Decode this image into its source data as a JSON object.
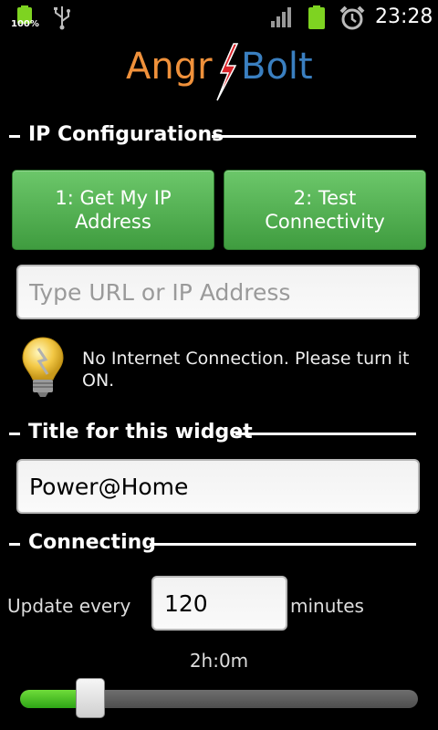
{
  "status_bar": {
    "battery_percent_label": "100%",
    "time": "23:28"
  },
  "app": {
    "logo_part1": "Angr",
    "logo_part2": "Bolt",
    "brand_orange": "#f0913b",
    "brand_blue": "#3a7fc0",
    "accent_green": "#4caf50"
  },
  "ip_section": {
    "title": "IP Configurations",
    "btn_get_ip": "1: Get My IP Address",
    "btn_test": "2: Test Connectivity",
    "url_input_value": "",
    "url_input_placeholder": "Type URL or IP Address",
    "status_icon": "lightbulb-icon",
    "status_message": "No Internet Connection. Please turn it ON."
  },
  "title_section": {
    "title": "Title for this widget",
    "widget_title_value": "Power@Home"
  },
  "connecting_section": {
    "title": "Connecting",
    "update_label": "Update every",
    "interval_value": "120",
    "interval_unit": "minutes",
    "duration_text": "2h:0m",
    "slider_fraction": 0.15
  }
}
